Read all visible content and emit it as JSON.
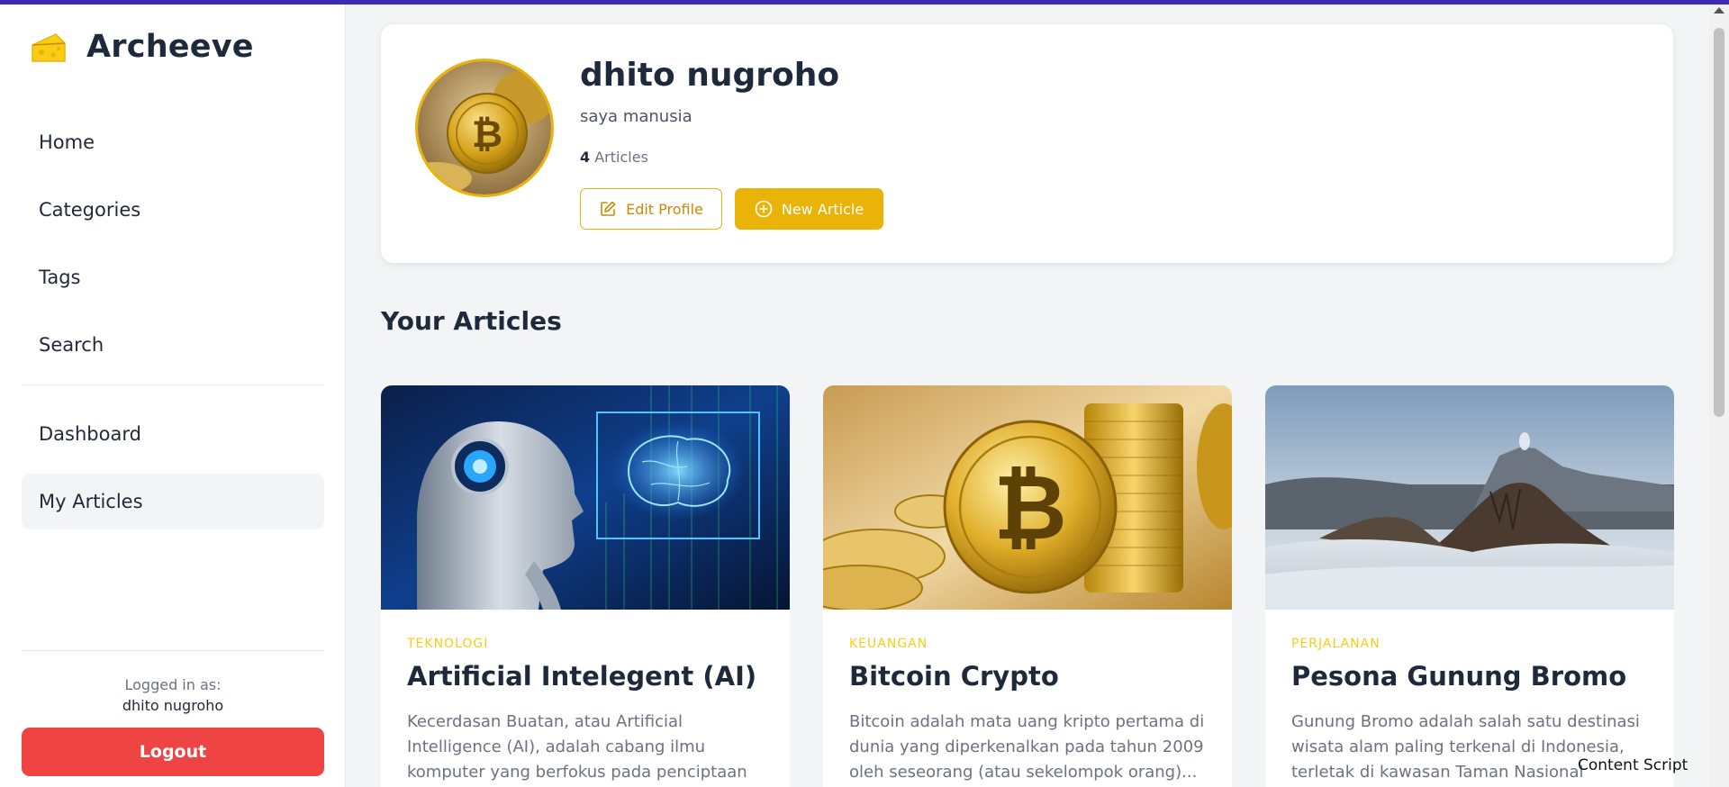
{
  "app": {
    "name": "Archeeve",
    "logo_icon": "cheese-icon"
  },
  "sidebar": {
    "items": [
      {
        "label": "Home"
      },
      {
        "label": "Categories"
      },
      {
        "label": "Tags"
      },
      {
        "label": "Search"
      },
      {
        "label": "Dashboard"
      },
      {
        "label": "My Articles",
        "active": true
      }
    ],
    "logged_in_label": "Logged in as:",
    "username": "dhito nugroho",
    "logout_label": "Logout"
  },
  "profile": {
    "name": "dhito nugroho",
    "bio": "saya manusia",
    "article_count": "4",
    "article_count_label": "Articles",
    "edit_label": "Edit Profile",
    "new_article_label": "New Article"
  },
  "articles_section": {
    "title": "Your Articles",
    "items": [
      {
        "category": "TEKNOLOGI",
        "title": "Artificial Intelegent (AI)",
        "desc": "Kecerdasan Buatan, atau Artificial Intelligence (AI), adalah cabang ilmu komputer yang berfokus pada penciptaan sistem yang dapa..."
      },
      {
        "category": "KEUANGAN",
        "title": "Bitcoin Crypto",
        "desc": "Bitcoin adalah mata uang kripto pertama di dunia yang diperkenalkan pada tahun 2009 oleh seseorang (atau sekelompok orang)..."
      },
      {
        "category": "PERJALANAN",
        "title": "Pesona Gunung Bromo",
        "desc": "Gunung Bromo adalah salah satu destinasi wisata alam paling terkenal di Indonesia, terletak di kawasan Taman Nasional Bromo..."
      }
    ]
  },
  "overlay": {
    "content_script": "Content Script"
  },
  "colors": {
    "accent": "#eab308",
    "danger": "#ef4444",
    "topbar": "#3b2bb3"
  }
}
